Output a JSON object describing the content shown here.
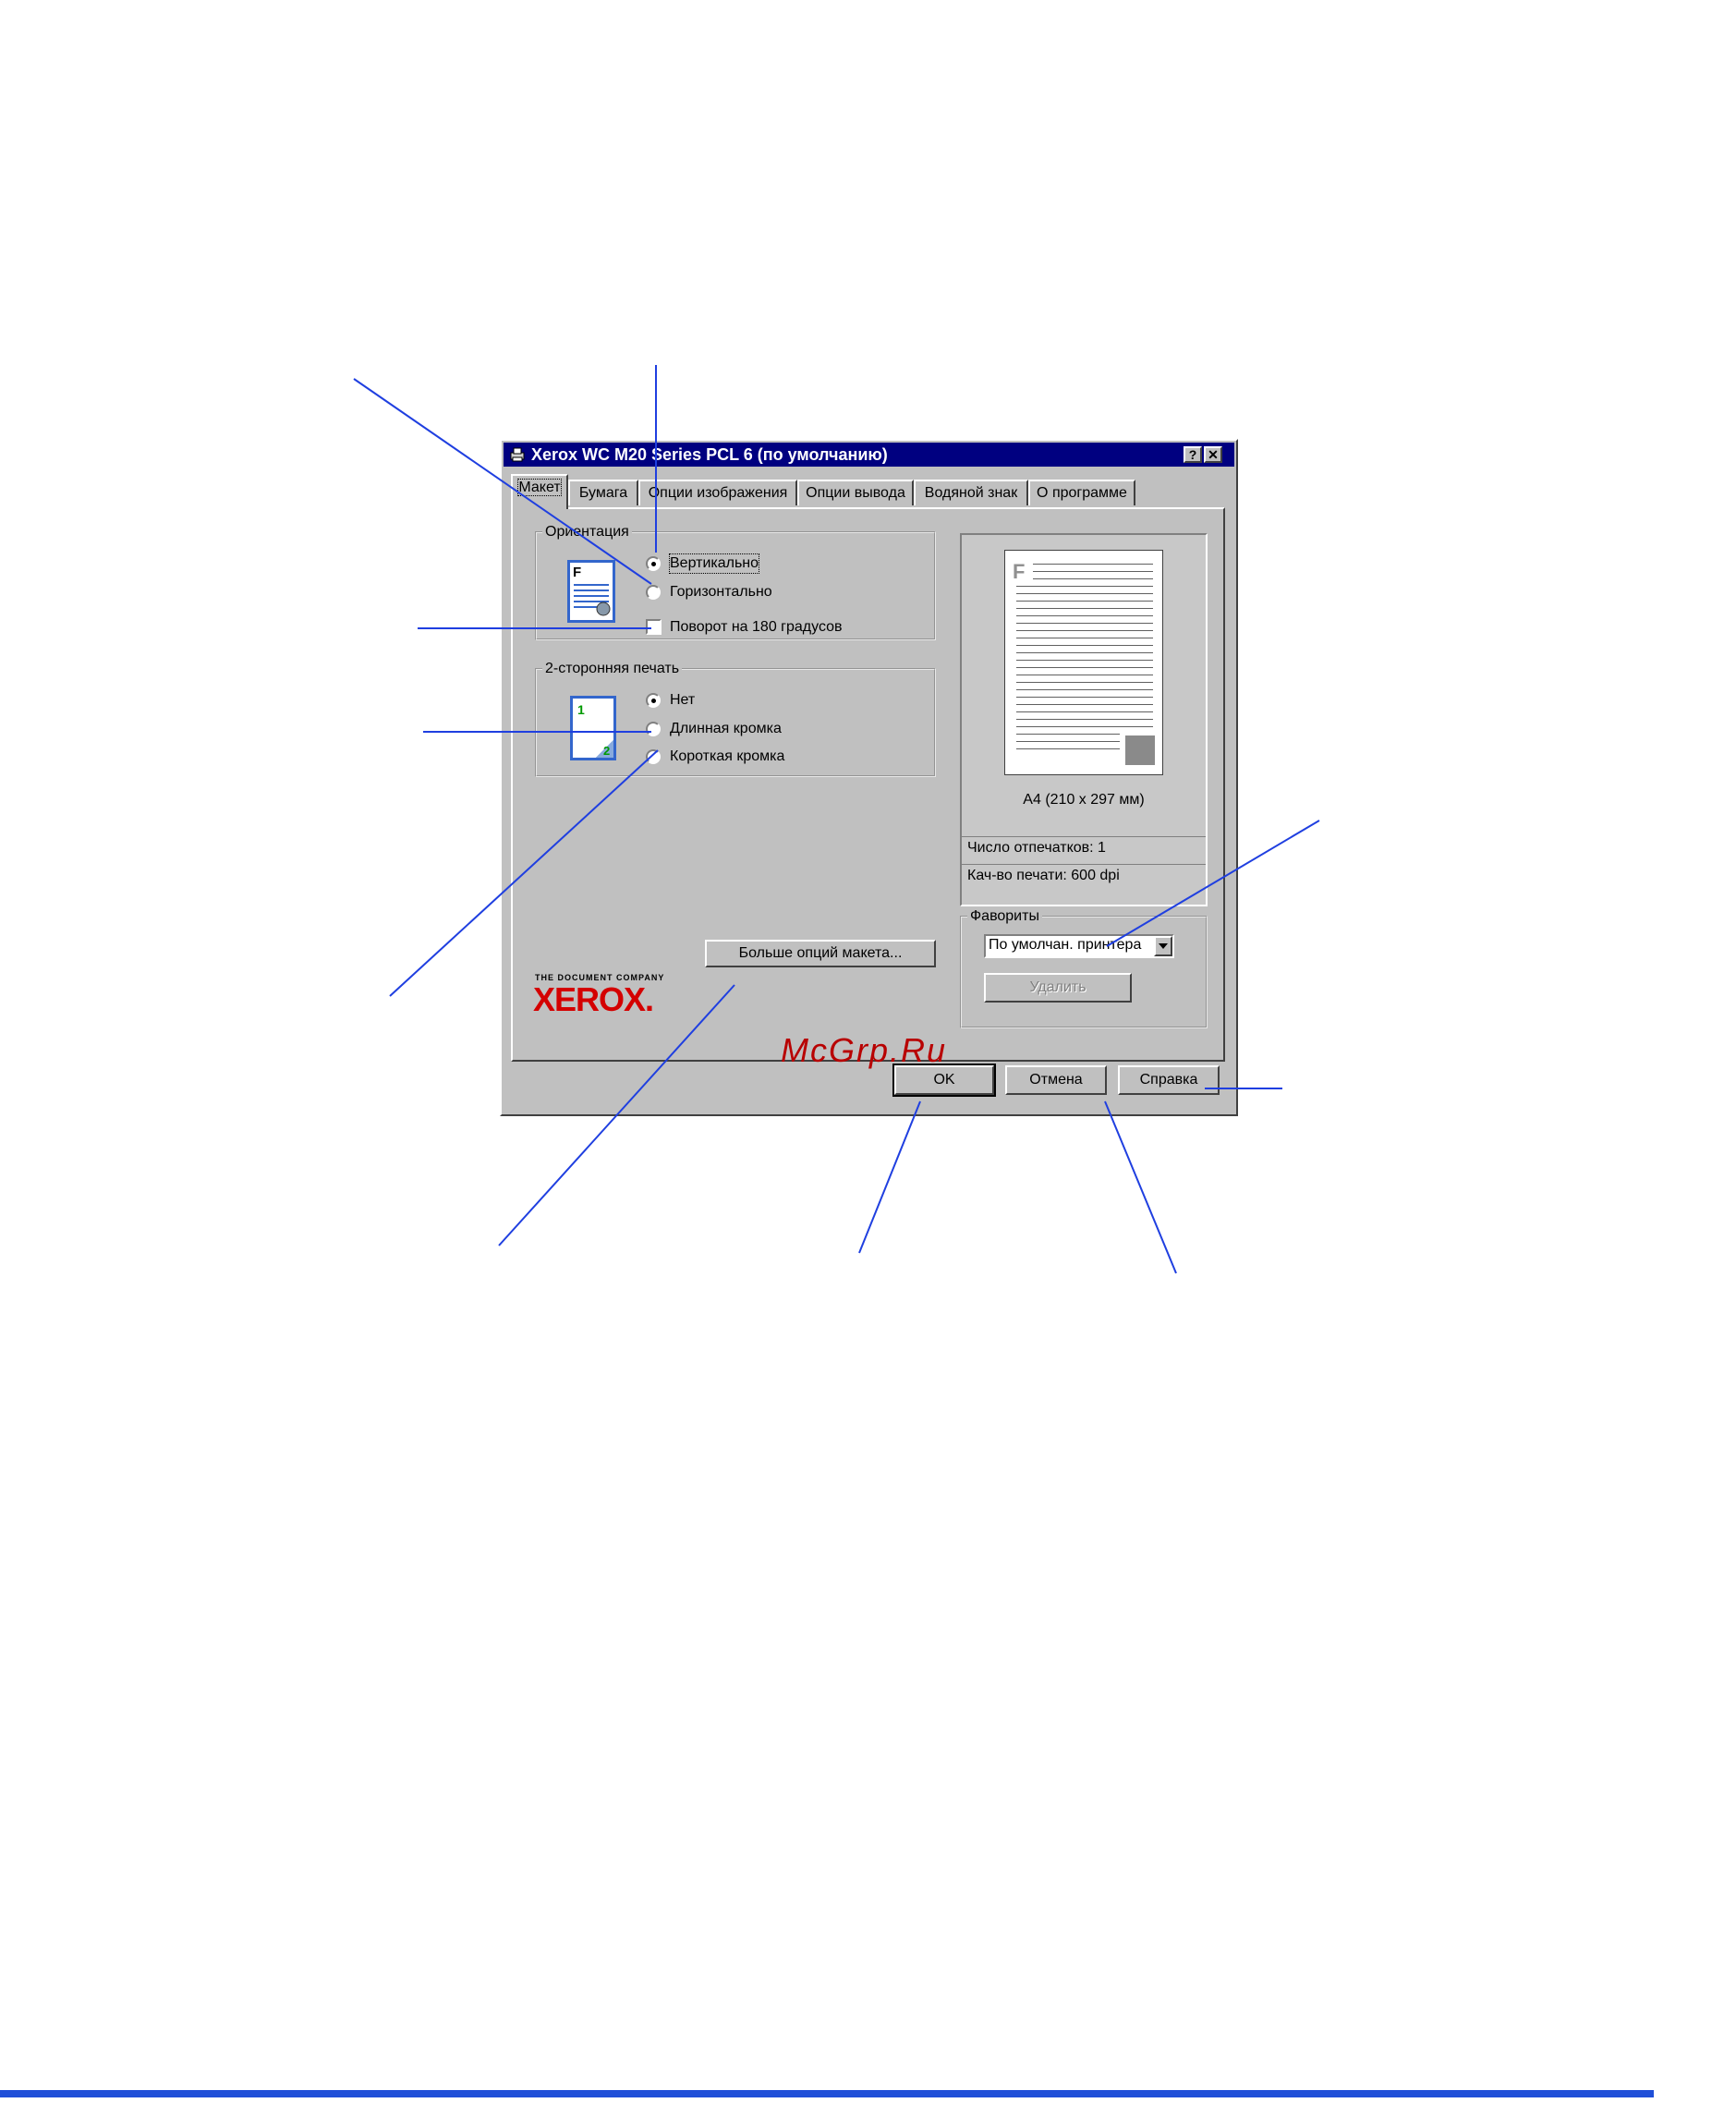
{
  "dialog": {
    "title": "Xerox WC M20 Series PCL 6 (по умолчанию)",
    "help_glyph": "?",
    "close_glyph": "✕",
    "tabs": [
      {
        "label": "Макет",
        "active": true
      },
      {
        "label": "Бумага",
        "active": false
      },
      {
        "label": "Опции изображения",
        "active": false
      },
      {
        "label": "Опции вывода",
        "active": false
      },
      {
        "label": "Водяной знак",
        "active": false
      },
      {
        "label": "О программе",
        "active": false
      }
    ]
  },
  "orientation": {
    "legend": "Ориентация",
    "portrait_label": "Вертикально",
    "landscape_label": "Горизонтально",
    "rotate_label": "Поворот на 180 градусов",
    "selected": "portrait",
    "rotate_checked": false
  },
  "duplex": {
    "legend": "2-сторонняя печать",
    "none_label": "Нет",
    "long_label": "Длинная кромка",
    "short_label": "Короткая кромка",
    "selected": "none"
  },
  "more_options_label": "Больше опций макета...",
  "brand": {
    "tagline": "THE DOCUMENT COMPANY",
    "logo": "XEROX."
  },
  "preview": {
    "paper_letter": "F",
    "paper_size": "A4 (210 x 297 мм)",
    "copies": "Число отпечатков: 1",
    "quality": "Кач-во печати: 600 dpi"
  },
  "favorites": {
    "legend": "Фавориты",
    "selected_value": "По умолчан. принтера",
    "delete_label": "Удалить"
  },
  "buttons": {
    "ok": "OK",
    "cancel": "Отмена",
    "help": "Справка"
  },
  "watermark": "McGrp.Ru",
  "colors": {
    "titlebar": "#000080",
    "face": "#c0c0c0",
    "callout_line": "#1f3fe0",
    "footer_bar": "#1f4fd8",
    "xerox_red": "#d40000"
  }
}
